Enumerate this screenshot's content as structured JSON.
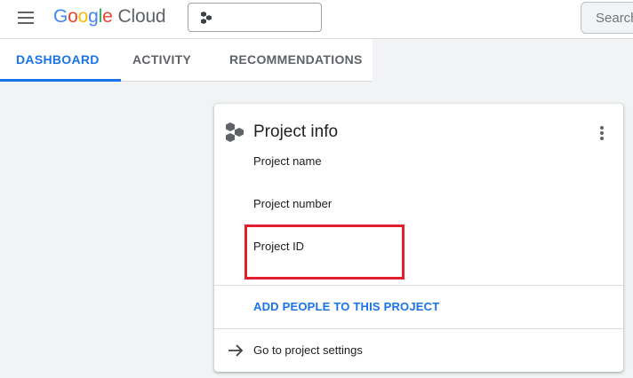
{
  "header": {
    "logo_brand": "Google",
    "logo_product": "Cloud",
    "search_placeholder": "Search",
    "icons": {
      "menu": "hamburger-menu-icon",
      "project": "project-hexagon-icon"
    }
  },
  "tabs": [
    {
      "label": "DASHBOARD",
      "active": true
    },
    {
      "label": "ACTIVITY",
      "active": false
    },
    {
      "label": "RECOMMENDATIONS",
      "active": false
    }
  ],
  "card": {
    "title": "Project info",
    "fields": [
      {
        "label": "Project name"
      },
      {
        "label": "Project number"
      },
      {
        "label": "Project ID"
      }
    ],
    "add_people_label": "ADD PEOPLE TO THIS PROJECT",
    "settings_label": "Go to project settings",
    "icons": {
      "header": "project-hexagon-icon",
      "more": "more-vert-icon",
      "settings": "arrow-right-icon"
    }
  },
  "colors": {
    "accent": "#1a73e8",
    "highlight": "#e0202a",
    "background": "#f1f3f4"
  }
}
